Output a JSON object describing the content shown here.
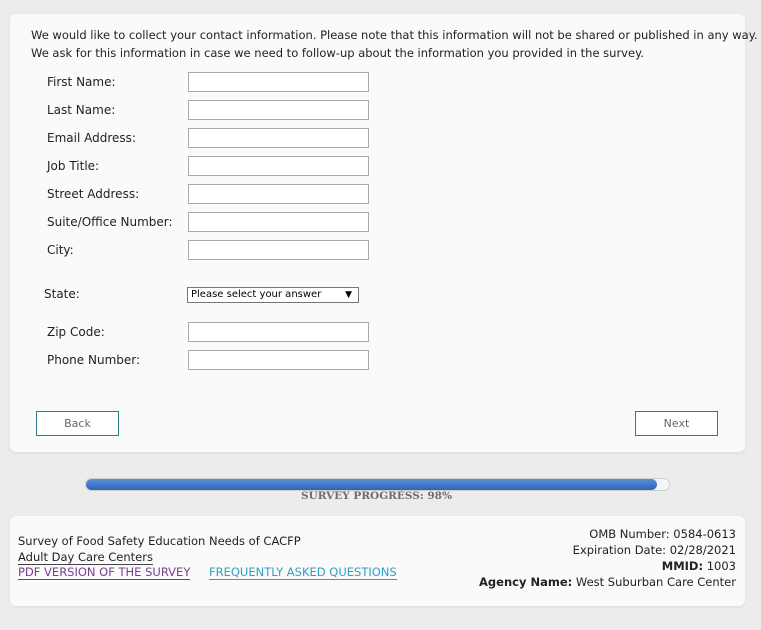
{
  "intro": {
    "line1": "We would like to collect your contact information. Please note that this information will not be shared or published in any way.",
    "line2": "We ask for this information in case we need to follow-up about the information you provided in the survey."
  },
  "fields": [
    {
      "label": "First Name:",
      "value": ""
    },
    {
      "label": "Last Name:",
      "value": ""
    },
    {
      "label": "Email Address:",
      "value": ""
    },
    {
      "label": "Job Title:",
      "value": ""
    },
    {
      "label": "Street Address:",
      "value": ""
    },
    {
      "label": "Suite/Office Number:",
      "value": ""
    },
    {
      "label": "City:",
      "value": ""
    }
  ],
  "state": {
    "label": "State:",
    "selected": "Please select your answer",
    "arrow": "▼"
  },
  "fields2": [
    {
      "label": "Zip Code:",
      "value": ""
    },
    {
      "label": "Phone Number:",
      "value": ""
    }
  ],
  "nav": {
    "back_label": "Back",
    "next_label": "Next"
  },
  "progress": {
    "text": "SURVEY PROGRESS: 98%",
    "value": 0.98,
    "color": "#2d65b8"
  },
  "footer": {
    "title_line1": "Survey of Food Safety Education Needs of CACFP",
    "title_line2": "Adult Day Care Centers",
    "pdf_link": "PDF VERSION OF THE SURVEY",
    "faq_link": "FREQUENTLY ASKED QUESTIONS",
    "omb": "OMB Number: 0584-0613",
    "expiration": "Expiration Date: 02/28/2021",
    "mmid_label": "MMID:",
    "mmid_value": "1003",
    "agency_label": "Agency Name:",
    "agency_value": "West Suburban Care Center"
  }
}
